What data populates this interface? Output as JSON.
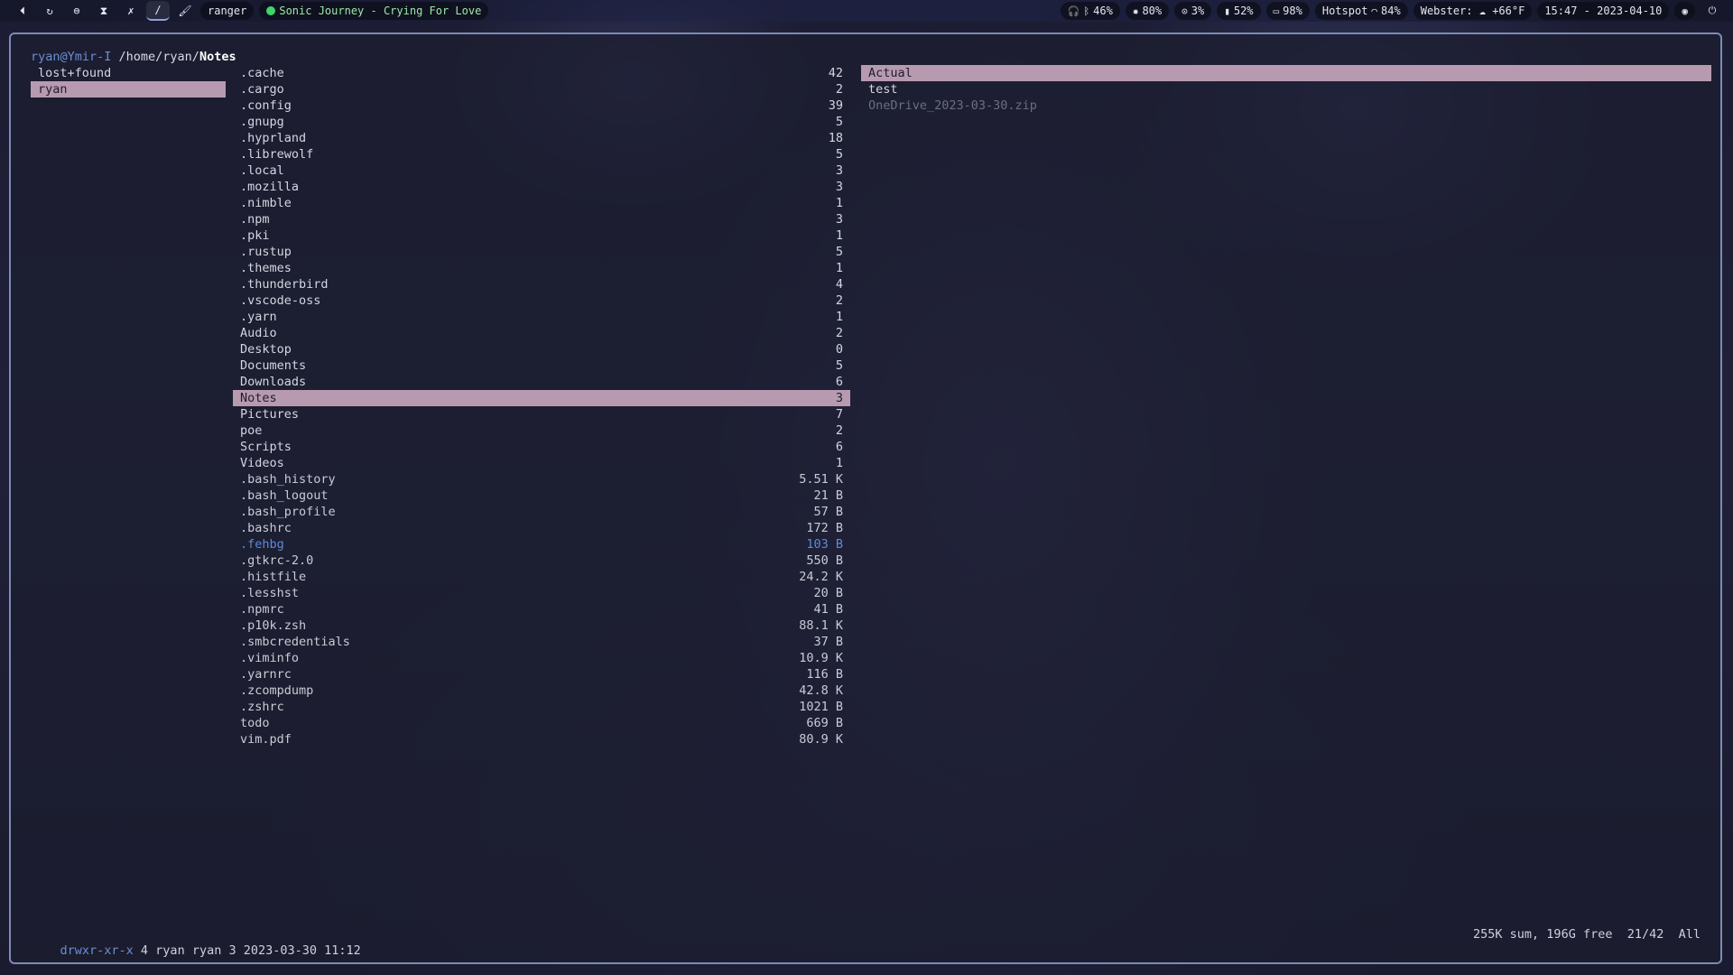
{
  "topbar": {
    "workspaces": [
      {
        "icon": "arrow-icon",
        "glyph": "⏴"
      },
      {
        "icon": "refresh-icon",
        "glyph": "↻"
      },
      {
        "icon": "circle-icon",
        "glyph": "⊜"
      },
      {
        "icon": "hourglass-icon",
        "glyph": "⧗"
      },
      {
        "icon": "code-icon",
        "glyph": "✗"
      },
      {
        "icon": "pen-icon",
        "glyph": "∕"
      },
      {
        "icon": "brush-icon",
        "glyph": "🖌"
      }
    ],
    "app_name": "ranger",
    "media": "Sonic Journey - Crying For Love",
    "modules": {
      "audio": "46%",
      "brightness": "80%",
      "cpu": "3%",
      "memory": "52%",
      "battery": "98%",
      "network": "Hotspot",
      "wifi": "84%",
      "weather": "Webster: ☁ +66°F",
      "clock": "15:47 - 2023-04-10"
    }
  },
  "terminal": {
    "host": "ryan@Ymir-I",
    "path_prefix": " /home/ryan/",
    "path_current": "Notes",
    "parent_column": [
      {
        "name": "lost+found",
        "selected": false
      },
      {
        "name": "ryan",
        "selected": true
      }
    ],
    "current_column": [
      {
        "name": ".cache",
        "size": "42",
        "kind": "dir"
      },
      {
        "name": ".cargo",
        "size": "2",
        "kind": "dir"
      },
      {
        "name": ".config",
        "size": "39",
        "kind": "dir"
      },
      {
        "name": ".gnupg",
        "size": "5",
        "kind": "dir"
      },
      {
        "name": ".hyprland",
        "size": "18",
        "kind": "dir"
      },
      {
        "name": ".librewolf",
        "size": "5",
        "kind": "dir"
      },
      {
        "name": ".local",
        "size": "3",
        "kind": "dir"
      },
      {
        "name": ".mozilla",
        "size": "3",
        "kind": "dir"
      },
      {
        "name": ".nimble",
        "size": "1",
        "kind": "dir"
      },
      {
        "name": ".npm",
        "size": "3",
        "kind": "dir"
      },
      {
        "name": ".pki",
        "size": "1",
        "kind": "dir"
      },
      {
        "name": ".rustup",
        "size": "5",
        "kind": "dir"
      },
      {
        "name": ".themes",
        "size": "1",
        "kind": "dir"
      },
      {
        "name": ".thunderbird",
        "size": "4",
        "kind": "dir"
      },
      {
        "name": ".vscode-oss",
        "size": "2",
        "kind": "dir"
      },
      {
        "name": ".yarn",
        "size": "1",
        "kind": "dir"
      },
      {
        "name": "Audio",
        "size": "2",
        "kind": "dir"
      },
      {
        "name": "Desktop",
        "size": "0",
        "kind": "dir"
      },
      {
        "name": "Documents",
        "size": "5",
        "kind": "dir"
      },
      {
        "name": "Downloads",
        "size": "6",
        "kind": "dir"
      },
      {
        "name": "Notes",
        "size": "3",
        "kind": "dir",
        "selected": true
      },
      {
        "name": "Pictures",
        "size": "7",
        "kind": "dir"
      },
      {
        "name": "poe",
        "size": "2",
        "kind": "dir"
      },
      {
        "name": "Scripts",
        "size": "6",
        "kind": "dir"
      },
      {
        "name": "Videos",
        "size": "1",
        "kind": "dir"
      },
      {
        "name": ".bash_history",
        "size": "5.51 K",
        "kind": "file"
      },
      {
        "name": ".bash_logout",
        "size": "21 B",
        "kind": "file"
      },
      {
        "name": ".bash_profile",
        "size": "57 B",
        "kind": "file"
      },
      {
        "name": ".bashrc",
        "size": "172 B",
        "kind": "file"
      },
      {
        "name": ".fehbg",
        "size": "103 B",
        "kind": "link"
      },
      {
        "name": ".gtkrc-2.0",
        "size": "550 B",
        "kind": "file"
      },
      {
        "name": ".histfile",
        "size": "24.2 K",
        "kind": "file"
      },
      {
        "name": ".lesshst",
        "size": "20 B",
        "kind": "file"
      },
      {
        "name": ".npmrc",
        "size": "41 B",
        "kind": "file"
      },
      {
        "name": ".p10k.zsh",
        "size": "88.1 K",
        "kind": "file"
      },
      {
        "name": ".smbcredentials",
        "size": "37 B",
        "kind": "file"
      },
      {
        "name": ".viminfo",
        "size": "10.9 K",
        "kind": "file"
      },
      {
        "name": ".yarnrc",
        "size": "116 B",
        "kind": "file"
      },
      {
        "name": ".zcompdump",
        "size": "42.8 K",
        "kind": "file"
      },
      {
        "name": ".zshrc",
        "size": "1021 B",
        "kind": "file"
      },
      {
        "name": "todo",
        "size": "669 B",
        "kind": "file"
      },
      {
        "name": "vim.pdf",
        "size": "80.9 K",
        "kind": "file"
      }
    ],
    "preview_column": [
      {
        "name": "Actual",
        "kind": "dir",
        "selected": true
      },
      {
        "name": "test",
        "kind": "dir"
      },
      {
        "name": "OneDrive_2023-03-30.zip",
        "kind": "dim"
      }
    ],
    "status": {
      "permissions": "drwxr-xr-x",
      "info": " 4 ryan ryan 3 2023-03-30 11:12",
      "summary": "255K sum, 196G free  21/42  All"
    }
  },
  "colors": {
    "accent_blue": "#6b8ed1",
    "selection": "#b89ab0",
    "border": "#7d8bb4",
    "media_green": "#3ed46a"
  }
}
